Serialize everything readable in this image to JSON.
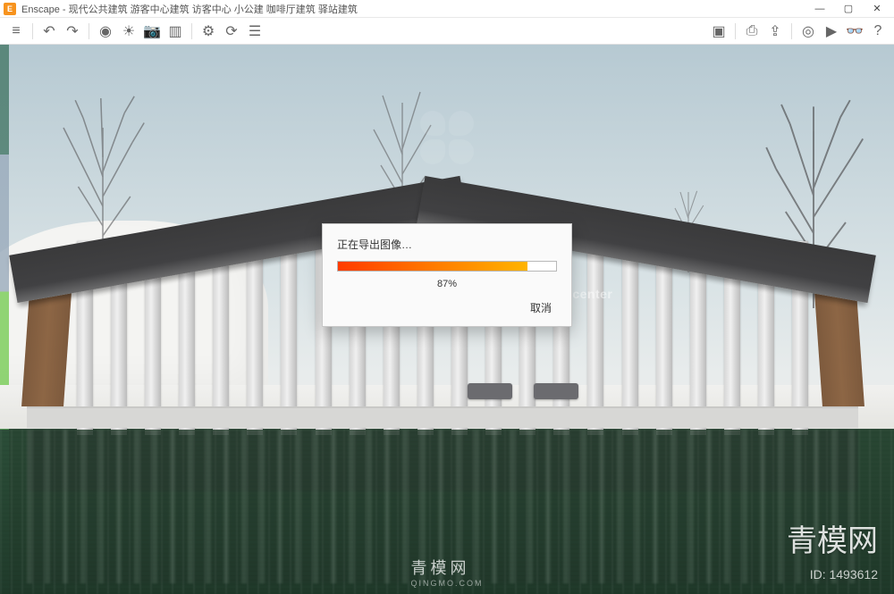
{
  "app": {
    "name": "Enscape",
    "title": "Enscape - 现代公共建筑 游客中心建筑 访客中心 小公建 咖啡厅建筑 驿站建筑"
  },
  "window_controls": {
    "minimize": "—",
    "maximize": "▢",
    "close": "✕"
  },
  "toolbar": {
    "items": [
      {
        "name": "menu-icon",
        "glyph": "≡"
      },
      {
        "name": "undo-icon",
        "glyph": "↶"
      },
      {
        "name": "redo-icon",
        "glyph": "↷"
      },
      {
        "name": "render-icon",
        "glyph": "◉"
      },
      {
        "name": "sun-icon",
        "glyph": "☀"
      },
      {
        "name": "camera-icon",
        "glyph": "📷"
      },
      {
        "name": "views-icon",
        "glyph": "▥"
      },
      {
        "name": "settings-icon",
        "glyph": "⚙"
      },
      {
        "name": "sync-icon",
        "glyph": "⟳"
      },
      {
        "name": "layers-icon",
        "glyph": "☰"
      }
    ],
    "right_items": [
      {
        "name": "viewport-icon",
        "glyph": "▣"
      },
      {
        "name": "batch-icon",
        "glyph": "⎙"
      },
      {
        "name": "export-icon",
        "glyph": "⇪"
      },
      {
        "name": "panorama-icon",
        "glyph": "◎"
      },
      {
        "name": "video-icon",
        "glyph": "▶"
      },
      {
        "name": "vr-icon",
        "glyph": "👓"
      },
      {
        "name": "help-icon",
        "glyph": "?"
      }
    ]
  },
  "progress_dialog": {
    "title": "正在导出图像…",
    "percent_value": 87,
    "percent_label": "87%",
    "cancel_label": "取消"
  },
  "scene": {
    "building_label": "r center"
  },
  "watermark": {
    "brand_big": "青模网",
    "brand_footer": "青模网",
    "url": "QINGMO.COM",
    "id_label": "ID: 1493612"
  }
}
